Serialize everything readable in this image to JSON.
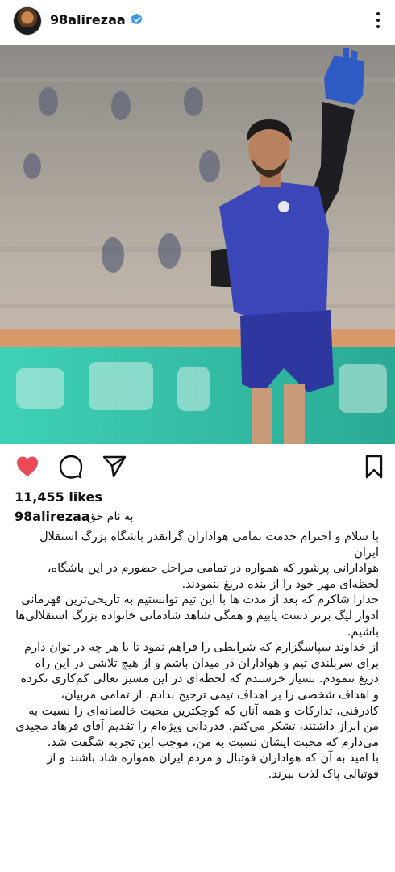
{
  "header": {
    "username": "98alirezaa",
    "verified_icon": "verified-badge-icon",
    "more_icon": "more-vertical-icon"
  },
  "photo": {
    "subject": "goalkeeper",
    "jersey_color": "#3b47b8",
    "background_color": "#b9b1a6",
    "pitch_border_color": "#2fb7a3"
  },
  "actions": {
    "like_icon": "heart-filled-icon",
    "comment_icon": "comment-icon",
    "share_icon": "send-icon",
    "save_icon": "bookmark-icon",
    "like_color": "#ed4956"
  },
  "post": {
    "likes": "11,455 likes",
    "caption_user": "98alirezaa",
    "caption_first_line": "به نام حق",
    "paragraphs": [
      "با سلام و احترام خدمت تمامی هواداران گرانقدر باشگاه بزرگ استقلال ایران",
      "هوادارانی پرشور که همواره در تمامی مراحل حضورم در این باشگاه، لحظه‌ای مهر خود را از بنده دریغ ننمودند.",
      "خدارا شاکرم که بعد از مدت ها با این تیم توانستیم به تاریخی‌ترین قهرمانی ادوار لیگ برتر دست یابیم و همگی شاهد شادمانی خانواده بزرگ استقلالی‌ها باشیم.",
      "از خداوند سپاسگزارم که شرایطی را فراهم نمود تا با هر چه در توان دارم برای سربلندی تیم و هواداران در میدان باشم و از هیچ تلاشی در این راه دریغ ننمودم. بسیار خرسندم که لحظه‌ای در این مسیر تعالی کم‌کاری نکرده و اهداف شخصی را بر اهداف تیمی ترجیح ندادم. از تمامی مربیان، کادرفنی، تدارکات و همه آنان که کوچکترین محبت خالصانه‌ای را نسبت به من ابراز داشتند، تشکر می‌کنم. قدردانی ویژه‌ام را تقدیم آقای فرهاد مجیدی می‌دارم که محبت ایشان نسبت به من، موجب این تجربه شگفت شد.",
      "با امید به آن که هواداران فوتبال و مردم ایران همواره شاد باشند و از فوتبالی پاک لذت ببرند."
    ]
  }
}
